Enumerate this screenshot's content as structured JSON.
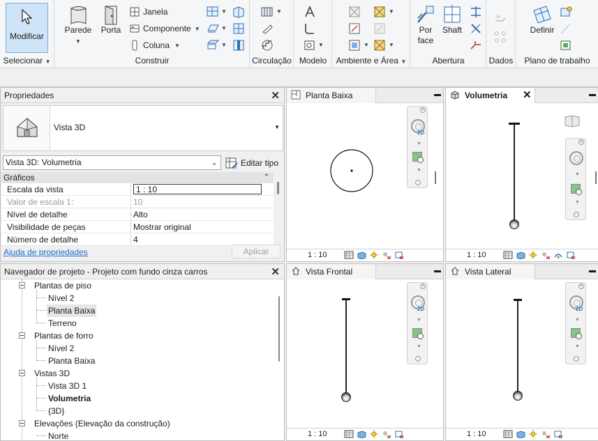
{
  "ribbon": {
    "select": {
      "button_label": "Modificar",
      "group_label": "Selecionar"
    },
    "build": {
      "group_label": "Construir",
      "wall": "Parede",
      "door": "Porta",
      "window": "Janela",
      "component": "Componente",
      "column": "Coluna"
    },
    "circulation": {
      "group_label": "Circulação"
    },
    "model": {
      "group_label": "Modelo"
    },
    "room_area": {
      "group_label": "Ambiente e Área"
    },
    "opening": {
      "group_label": "Abertura",
      "by_face_1": "Por",
      "by_face_2": "face",
      "shaft": "Shaft"
    },
    "datum": {
      "group_label": "Dados"
    },
    "work_plane": {
      "group_label": "Plano de trabalho",
      "set": "Definir"
    }
  },
  "properties": {
    "title": "Propriedades",
    "type_name": "Vista 3D",
    "view_selector": "Vista 3D: Volumetria",
    "edit_type": "Editar tipo",
    "section": "Gráficos",
    "rows": [
      {
        "key": "Escala da vista",
        "value": "1 : 10"
      },
      {
        "key": "Valor de escala    1:",
        "value": "10"
      },
      {
        "key": "Nível de detalhe",
        "value": "Alto"
      },
      {
        "key": "Visibilidade de peças",
        "value": "Mostrar original"
      },
      {
        "key": "Número de detalhe",
        "value": "4"
      }
    ],
    "help_link": "Ajuda de propriedades",
    "apply": "Aplicar"
  },
  "browser": {
    "title": "Navegador de projeto - Projeto com fundo cinza carros",
    "nodes": [
      "Plantas de piso",
      "Nível 2",
      "Planta Baixa",
      "Terreno",
      "Plantas de forro",
      "Nível 2",
      "Planta Baixa",
      "Vistas 3D",
      "Vista 3D 1",
      "Volumetria",
      "{3D}",
      "Elevações (Elevação da construção)",
      "Norte"
    ]
  },
  "views": {
    "plan": {
      "title": "Planta Baixa",
      "scale": "1 : 10"
    },
    "volumetria": {
      "title": "Volumetria",
      "scale": "1 : 10"
    },
    "front": {
      "title": "Vista Frontal",
      "scale": "1 : 10"
    },
    "side": {
      "title": "Vista Lateral",
      "scale": "1 : 10"
    }
  },
  "colors": {
    "selected_button": "#cfe4f7",
    "link": "#1a6fc9",
    "nav_2d": "#2a7fd6"
  }
}
